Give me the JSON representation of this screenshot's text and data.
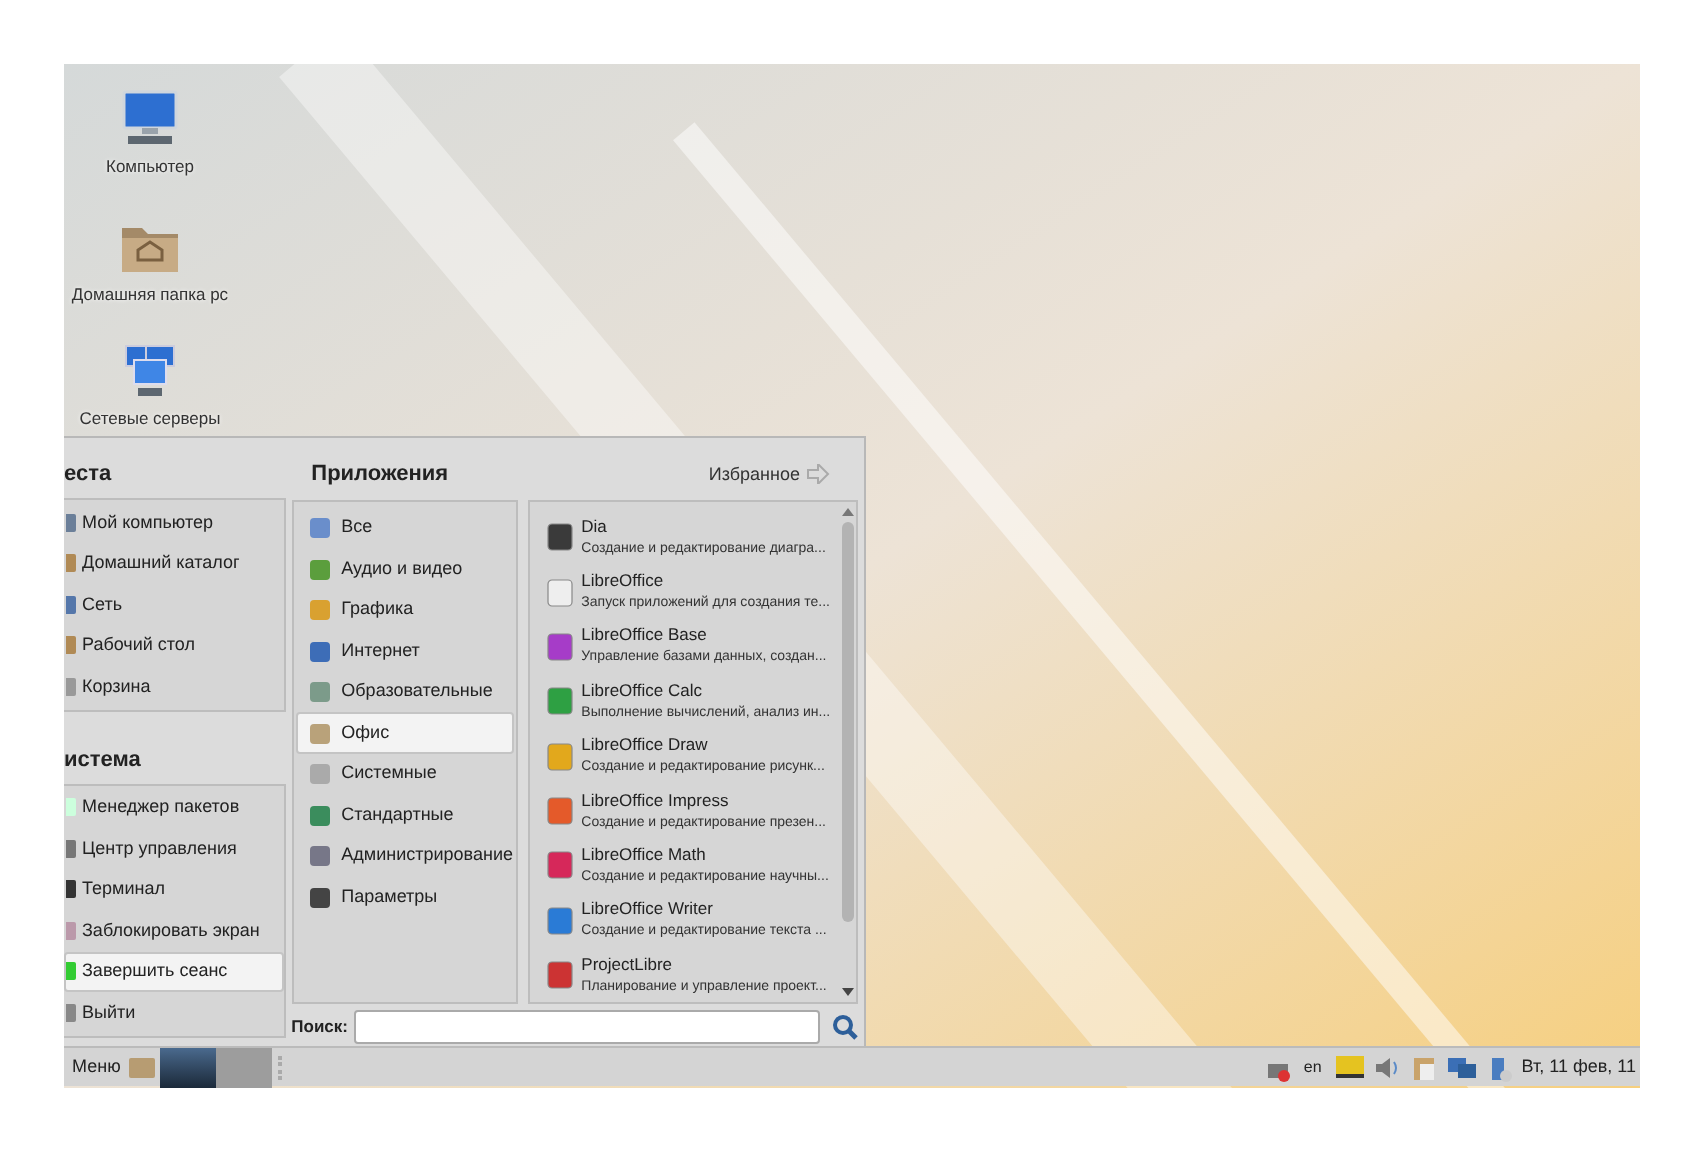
{
  "desktop_icons": [
    {
      "label": "Компьютер",
      "kind": "computer"
    },
    {
      "label": "Домашняя папка pc",
      "kind": "home"
    },
    {
      "label": "Сетевые серверы",
      "kind": "network"
    }
  ],
  "menu": {
    "places": {
      "title": "еста",
      "items": [
        {
          "label": "Мой компьютер",
          "selected": false
        },
        {
          "label": "Домашний каталог",
          "selected": false
        },
        {
          "label": "Сеть",
          "selected": false
        },
        {
          "label": "Рабочий стол",
          "selected": false
        },
        {
          "label": "Корзина",
          "selected": false
        }
      ]
    },
    "system": {
      "title": "истема",
      "items": [
        {
          "label": "Менеджер пакетов",
          "selected": false
        },
        {
          "label": "Центр управления",
          "selected": false
        },
        {
          "label": "Терминал",
          "selected": false
        },
        {
          "label": "Заблокировать экран",
          "selected": false
        },
        {
          "label": "Завершить сеанс",
          "selected": true
        },
        {
          "label": "Выйти",
          "selected": false
        }
      ]
    },
    "applications": {
      "title": "Приложения",
      "favorites_link": "Избранное",
      "categories": [
        {
          "label": "Все",
          "selected": false
        },
        {
          "label": "Аудио и видео",
          "selected": false
        },
        {
          "label": "Графика",
          "selected": false
        },
        {
          "label": "Интернет",
          "selected": false
        },
        {
          "label": "Образовательные",
          "selected": false
        },
        {
          "label": "Офис",
          "selected": true
        },
        {
          "label": "Системные",
          "selected": false
        },
        {
          "label": "Стандартные",
          "selected": false
        },
        {
          "label": "Администрирование",
          "selected": false
        },
        {
          "label": "Параметры",
          "selected": false
        }
      ],
      "apps": [
        {
          "name": "Dia",
          "description": "Создание и редактирование диагра..."
        },
        {
          "name": "LibreOffice",
          "description": "Запуск приложений для создания те..."
        },
        {
          "name": "LibreOffice Base",
          "description": "Управление базами данных, создан..."
        },
        {
          "name": "LibreOffice Calc",
          "description": "Выполнение вычислений, анализ ин..."
        },
        {
          "name": "LibreOffice Draw",
          "description": "Создание и редактирование рисунк..."
        },
        {
          "name": "LibreOffice Impress",
          "description": "Создание и редактирование презен..."
        },
        {
          "name": "LibreOffice Math",
          "description": "Создание и редактирование научны..."
        },
        {
          "name": "LibreOffice Writer",
          "description": "Создание и редактирование текста ..."
        },
        {
          "name": "ProjectLibre",
          "description": "Планирование и управление проект..."
        }
      ],
      "search": {
        "label": "Поиск:"
      }
    }
  },
  "taskbar": {
    "menu_label": "Меню",
    "language": "en",
    "clock": "Вт, 11 фев, 11"
  }
}
